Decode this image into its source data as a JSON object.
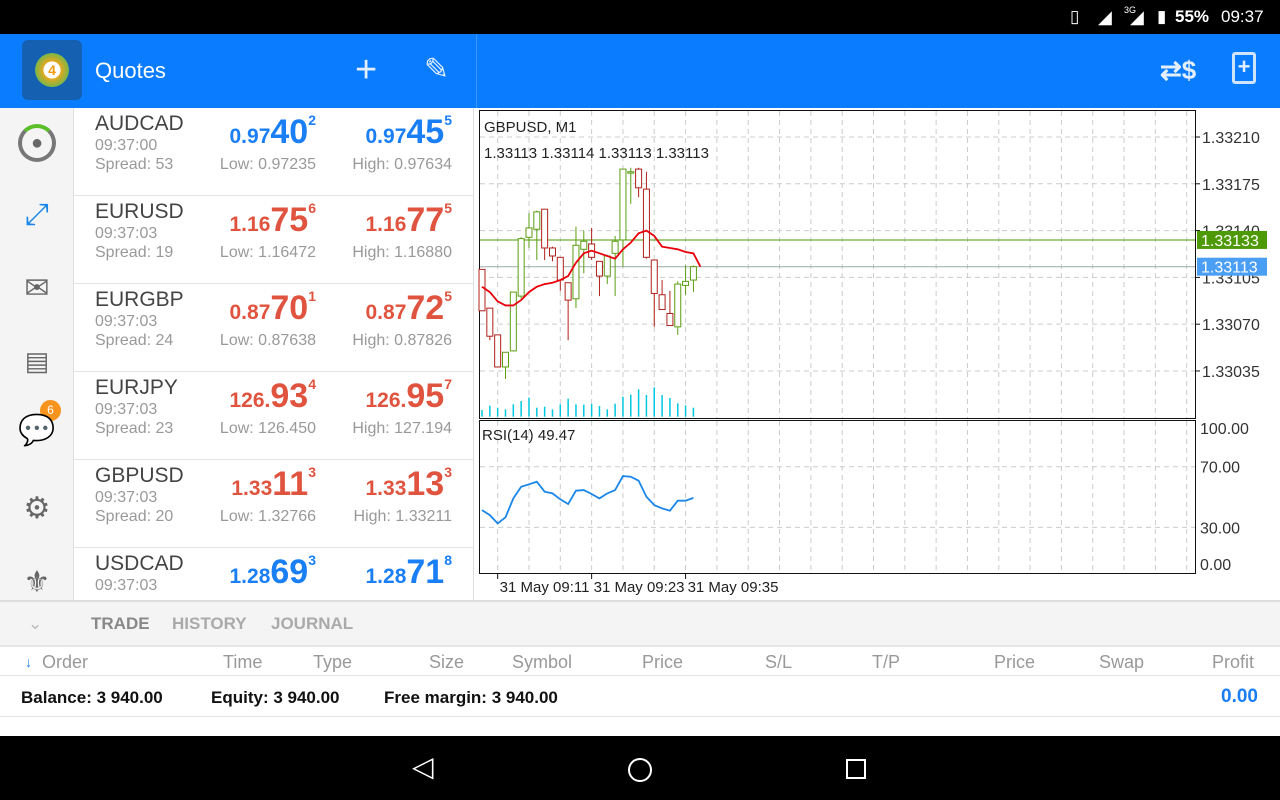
{
  "status": {
    "battery": "55%",
    "time": "09:37",
    "network": "3G"
  },
  "header": {
    "title": "Quotes",
    "icons": [
      "mt4-logo-icon",
      "add-icon",
      "edit-pencil-icon",
      "currency-exchange-icon",
      "new-order-icon"
    ]
  },
  "sidebar": {
    "items": [
      "account-icon",
      "trade-icon",
      "mail-icon",
      "news-icon",
      "chat-icon",
      "settings-icon",
      "community-icon"
    ],
    "mail_badge": "6"
  },
  "quotes": [
    {
      "symbol": "AUDCAD",
      "time": "09:37:00",
      "spread": "Spread: 53",
      "bid": [
        "0.97",
        "40",
        "2"
      ],
      "ask": [
        "0.97",
        "45",
        "5"
      ],
      "low": "Low: 0.97235",
      "high": "High: 0.97634",
      "color": "#1a7ef5"
    },
    {
      "symbol": "EURUSD",
      "time": "09:37:03",
      "spread": "Spread: 19",
      "bid": [
        "1.16",
        "75",
        "6"
      ],
      "ask": [
        "1.16",
        "77",
        "5"
      ],
      "low": "Low: 1.16472",
      "high": "High: 1.16880",
      "color": "#e0533f"
    },
    {
      "symbol": "EURGBP",
      "time": "09:37:03",
      "spread": "Spread: 24",
      "bid": [
        "0.87",
        "70",
        "1"
      ],
      "ask": [
        "0.87",
        "72",
        "5"
      ],
      "low": "Low: 0.87638",
      "high": "High: 0.87826",
      "color": "#e0533f"
    },
    {
      "symbol": "EURJPY",
      "time": "09:37:03",
      "spread": "Spread: 23",
      "bid": [
        "126.",
        "93",
        "4"
      ],
      "ask": [
        "126.",
        "95",
        "7"
      ],
      "low": "Low: 126.450",
      "high": "High: 127.194",
      "color": "#e0533f"
    },
    {
      "symbol": "GBPUSD",
      "time": "09:37:03",
      "spread": "Spread: 20",
      "bid": [
        "1.33",
        "11",
        "3"
      ],
      "ask": [
        "1.33",
        "13",
        "3"
      ],
      "low": "Low: 1.32766",
      "high": "High: 1.33211",
      "color": "#e0533f"
    },
    {
      "symbol": "USDCAD",
      "time": "09:37:03",
      "spread": "",
      "bid": [
        "1.28",
        "69",
        "3"
      ],
      "ask": [
        "1.28",
        "71",
        "8"
      ],
      "low": "",
      "high": "",
      "color": "#1a7ef5"
    }
  ],
  "chart_data": {
    "type": "candlestick",
    "title": "GBPUSD, M1",
    "ohlc_label": "1.33113 1.33114 1.33113 1.33113",
    "price_ticks": [
      "1.33210",
      "1.33175",
      "1.33140",
      "1.33105",
      "1.33070",
      "1.33035"
    ],
    "ask_line": "1.33133",
    "bid_line": "1.33113",
    "colors": {
      "bull": "#5a9e0f",
      "bear": "#b0201a",
      "ma": "#e8000b",
      "rsi": "#1a86e8",
      "volume": "#00c8e0",
      "ask": "#4e9a06",
      "bid": "#4a9ff5"
    },
    "time_labels": [
      "31 May 09:11",
      "31 May 09:23",
      "31 May 09:35"
    ],
    "time_label_index": [
      2,
      14,
      26
    ],
    "candles": [
      [
        1.33111,
        1.33111,
        1.3308,
        1.3308
      ],
      [
        1.33082,
        1.33082,
        1.33058,
        1.33061
      ],
      [
        1.33062,
        1.33062,
        1.33038,
        1.33038
      ],
      [
        1.33038,
        1.33049,
        1.33029,
        1.33049
      ],
      [
        1.3305,
        1.33094,
        1.3305,
        1.33094
      ],
      [
        1.33091,
        1.33135,
        1.33089,
        1.33134
      ],
      [
        1.33135,
        1.33153,
        1.33127,
        1.33142
      ],
      [
        1.33141,
        1.33155,
        1.33118,
        1.33154
      ],
      [
        1.33156,
        1.33156,
        1.33118,
        1.33127
      ],
      [
        1.33127,
        1.33128,
        1.33117,
        1.33121
      ],
      [
        1.3312,
        1.3312,
        1.33095,
        1.33103
      ],
      [
        1.33101,
        1.33101,
        1.33058,
        1.33088
      ],
      [
        1.33089,
        1.33143,
        1.33082,
        1.33129
      ],
      [
        1.33126,
        1.3314,
        1.33108,
        1.33132
      ],
      [
        1.3313,
        1.33142,
        1.33118,
        1.3312
      ],
      [
        1.33117,
        1.33117,
        1.33091,
        1.33106
      ],
      [
        1.33106,
        1.33122,
        1.331,
        1.33121
      ],
      [
        1.33123,
        1.33136,
        1.33091,
        1.33132
      ],
      [
        1.33133,
        1.33186,
        1.33113,
        1.33186
      ],
      [
        1.33183,
        1.33187,
        1.3316,
        1.33184
      ],
      [
        1.33186,
        1.33187,
        1.33165,
        1.33172
      ],
      [
        1.33171,
        1.33184,
        1.33119,
        1.3312
      ],
      [
        1.33118,
        1.33118,
        1.33068,
        1.33093
      ],
      [
        1.33092,
        1.33103,
        1.33081,
        1.33081
      ],
      [
        1.33078,
        1.33095,
        1.33069,
        1.33069
      ],
      [
        1.33068,
        1.33102,
        1.33062,
        1.331
      ],
      [
        1.33099,
        1.33114,
        1.33092,
        1.33102
      ],
      [
        1.33103,
        1.33114,
        1.33094,
        1.33113
      ]
    ],
    "ma": [
      1.33098,
      1.33094,
      1.33087,
      1.33084,
      1.33084,
      1.33088,
      1.33094,
      1.33098,
      1.331,
      1.33101,
      1.33103,
      1.33106,
      1.33116,
      1.33123,
      1.33125,
      1.33123,
      1.33121,
      1.33119,
      1.33126,
      1.33131,
      1.33138,
      1.3314,
      1.33136,
      1.33128,
      1.33127,
      1.33126,
      1.33124,
      1.33123
    ],
    "volume": [
      20,
      33,
      27,
      22,
      37,
      47,
      57,
      27,
      30,
      22,
      37,
      54,
      37,
      36,
      38,
      32,
      22,
      39,
      60,
      66,
      82,
      65,
      88,
      65,
      56,
      40,
      34,
      27
    ],
    "rsi_label": "RSI(14) 49.47",
    "rsi_ticks": [
      "100.00",
      "70.00",
      "30.00",
      "0.00"
    ],
    "rsi": [
      41.4,
      38.1,
      32.6,
      36.6,
      49.1,
      56.8,
      58.4,
      60.1,
      53.5,
      52.4,
      48.5,
      45.4,
      54.2,
      54.6,
      52,
      49.1,
      52.4,
      54.6,
      63.8,
      63.4,
      60.8,
      50.2,
      44.7,
      42.5,
      41,
      47.6,
      47.6,
      49.47
    ]
  },
  "bottom": {
    "tabs": [
      "TRADE",
      "HISTORY",
      "JOURNAL"
    ],
    "columns": [
      "Order",
      "Time",
      "Type",
      "Size",
      "Symbol",
      "Price",
      "S/L",
      "T/P",
      "Price",
      "Swap",
      "Profit"
    ],
    "balance": "Balance:  3 940.00",
    "equity": "Equity:  3 940.00",
    "free_margin": "Free margin:  3 940.00",
    "profit": "0.00"
  }
}
